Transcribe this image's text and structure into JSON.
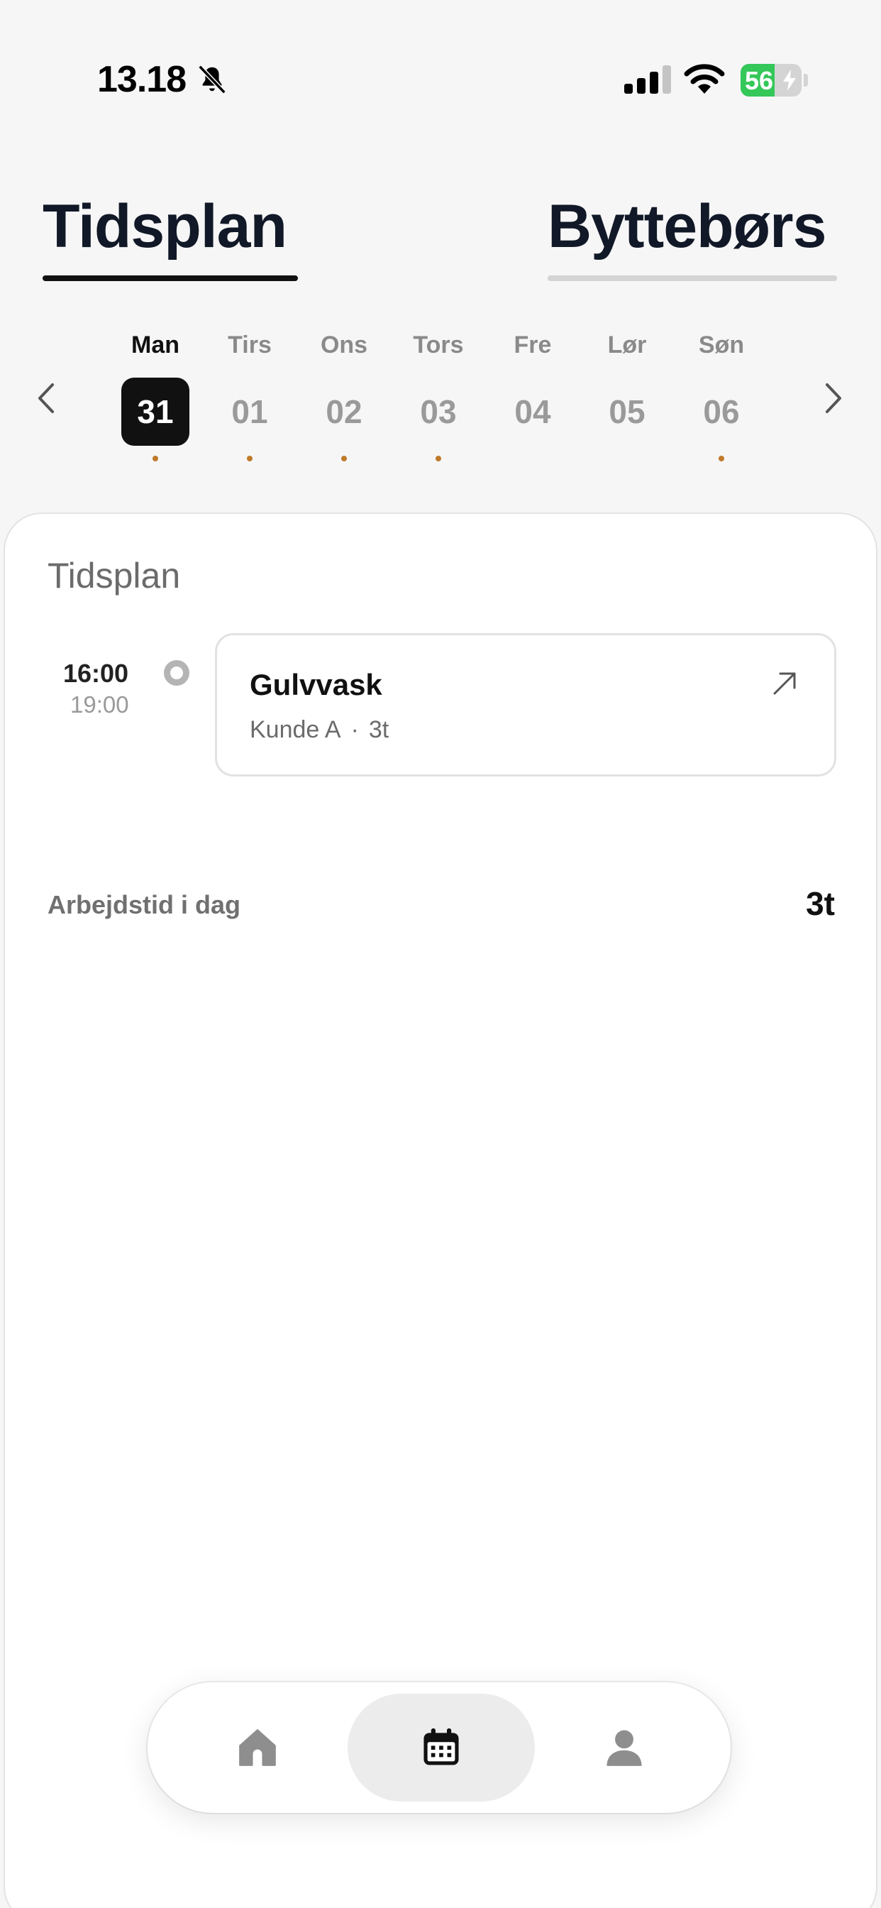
{
  "status_bar": {
    "time": "13.18",
    "battery": "56",
    "icons": [
      "bell-slash-icon",
      "signal-icon",
      "wifi-icon",
      "battery-charging-icon"
    ]
  },
  "tabs": [
    {
      "label": "Tidsplan",
      "active": true
    },
    {
      "label": "Byttebørs",
      "active": false
    }
  ],
  "week": {
    "days": [
      {
        "name": "Man",
        "num": "31",
        "selected": true,
        "has_event": true
      },
      {
        "name": "Tirs",
        "num": "01",
        "selected": false,
        "has_event": true
      },
      {
        "name": "Ons",
        "num": "02",
        "selected": false,
        "has_event": true
      },
      {
        "name": "Tors",
        "num": "03",
        "selected": false,
        "has_event": true
      },
      {
        "name": "Fre",
        "num": "04",
        "selected": false,
        "has_event": false
      },
      {
        "name": "Lør",
        "num": "05",
        "selected": false,
        "has_event": false
      },
      {
        "name": "Søn",
        "num": "06",
        "selected": false,
        "has_event": true
      }
    ]
  },
  "schedule": {
    "title": "Tidsplan",
    "events": [
      {
        "start": "16:00",
        "end": "19:00",
        "title": "Gulvvask",
        "customer": "Kunde A",
        "separator": "·",
        "duration": "3t"
      }
    ],
    "workday_label": "Arbejdstid i dag",
    "workday_value": "3t"
  },
  "colors": {
    "accent_dot": "#c07a2a",
    "selected_day_bg": "#111111",
    "battery_green": "#34c759"
  },
  "nav": {
    "items": [
      {
        "icon": "home-icon",
        "active": false
      },
      {
        "icon": "calendar-icon",
        "active": true
      },
      {
        "icon": "person-icon",
        "active": false
      }
    ]
  }
}
